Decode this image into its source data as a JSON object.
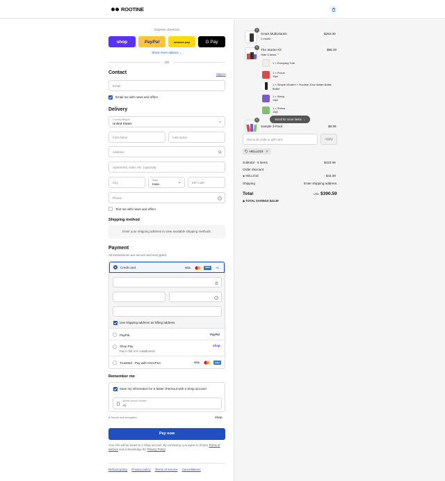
{
  "header": {
    "brand": "ROOTINE"
  },
  "express": {
    "title": "Express checkout",
    "shop_label": "shop",
    "paypal_label": "PayPal",
    "amazon_label": "amazon pay",
    "gpay_label": "G Pay",
    "show_more": "Show more options",
    "or": "OR"
  },
  "contact": {
    "heading": "Contact",
    "sign_in": "Sign in",
    "email_placeholder": "Email",
    "news_label": "Email me with news and offers"
  },
  "delivery": {
    "heading": "Delivery",
    "country_label": "Country/Region",
    "country_value": "United States",
    "first_name": "First name",
    "last_name": "Last name",
    "address": "Address",
    "apartment": "Apartment, suite, etc. (optional)",
    "city": "City",
    "state_label": "State",
    "state_value": "Iowa",
    "zip": "ZIP code",
    "phone": "Phone",
    "text_me": "Text me with news and offers"
  },
  "shipping": {
    "heading": "Shipping method",
    "note": "Enter your shipping address to view available shipping methods."
  },
  "payment": {
    "heading": "Payment",
    "subtitle": "All transactions are secure and encrypted.",
    "credit_card": "Credit card",
    "more_cards": "+1",
    "billing_same": "Use shipping address as billing address",
    "paypal": "PayPal",
    "paypal_logo": "PayPal",
    "shop_pay": "Shop Pay",
    "shop_pay_sub": "Pay in full or in installments",
    "shop_logo": "shop",
    "truemed": "TrueMed - Pay with HSA/FSA",
    "visa": "VISA",
    "amex": "AMEX"
  },
  "remember": {
    "heading": "Remember me",
    "save_label": "Save my information for a faster checkout with a Shop account",
    "mobile_label": "Mobile phone number",
    "mobile_value": "+1",
    "secure": "Secure and encrypted",
    "shop_logo": "shop"
  },
  "pay_now": "Pay now",
  "legal": {
    "text": "Your info will be saved to a Shop account. By continuing, you agree to Shop's",
    "terms": "Terms of Service",
    "and": "and acknowledge the",
    "privacy": "Privacy Policy",
    "end": "."
  },
  "footer": {
    "links": [
      "Refund policy",
      "Privacy policy",
      "Terms of service",
      "Cancellations"
    ]
  },
  "summary": {
    "items": [
      {
        "qty": "1",
        "name": "Smart Multivitamin",
        "sub": "1 month",
        "price": "$282.00"
      },
      {
        "qty": "1",
        "name": "The Starter Kit",
        "sub": "Hide 5 items",
        "price": "$95.00"
      },
      {
        "qty": "1",
        "name": "Sample 3-Pack",
        "sub": "",
        "price": "$9.99"
      }
    ],
    "kit_items": [
      {
        "name": "1 × Everyday Tote",
        "sub": ""
      },
      {
        "name": "1 × Focus",
        "sub": "10pk"
      },
      {
        "name": "1 × Simple Modern + Rootine 20oz Water Bottle",
        "sub": ""
      },
      {
        "name": "1 × Sleep",
        "sub": "10pk"
      },
      {
        "name": "1 × Stress",
        "sub": "10pk"
      }
    ],
    "scroll_hint": "Scroll for more items",
    "discount_placeholder": "Discount code or gift card",
    "apply": "Apply",
    "code": "HELLO10",
    "subtotal_label": "Subtotal · 5 items",
    "subtotal_value": "$433.99",
    "order_discount_label": "Order discount",
    "order_discount_code": "HELLO10",
    "order_discount_value": "- $43.39",
    "shipping_label": "Shipping",
    "shipping_value": "Enter shipping address",
    "total_label": "Total",
    "currency": "USD",
    "total_value": "$390.59",
    "savings_label": "TOTAL SAVINGS",
    "savings_value": "$43.39"
  },
  "colors": {
    "accent": "#1f4fc0",
    "shop": "#5a31f4",
    "paypal": "#ffc439",
    "panel": "#f5f5f5"
  }
}
